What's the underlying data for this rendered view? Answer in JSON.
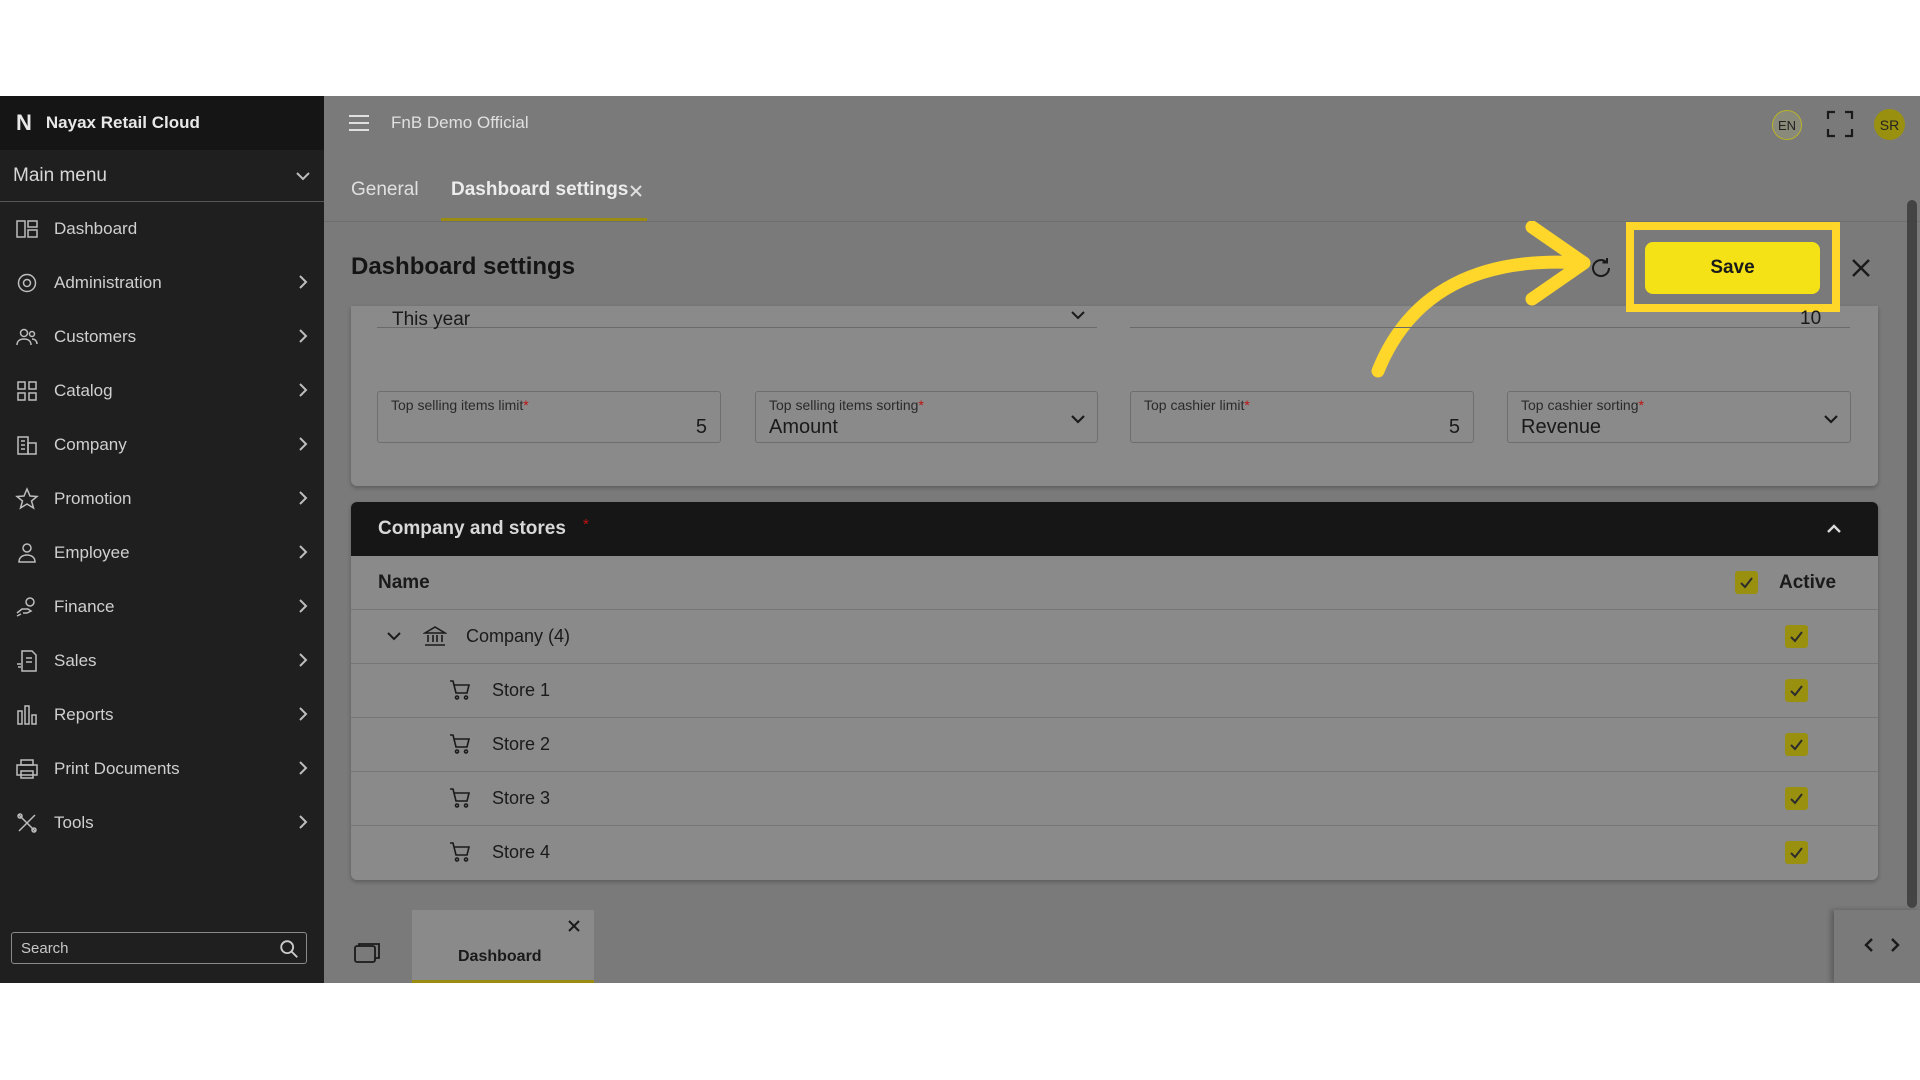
{
  "sidebar": {
    "brand": "Nayax Retail Cloud",
    "main_menu": "Main menu",
    "items": [
      {
        "label": "Dashboard",
        "icon": "dashboard-icon"
      },
      {
        "label": "Administration",
        "icon": "admin-gear-icon"
      },
      {
        "label": "Customers",
        "icon": "customers-icon"
      },
      {
        "label": "Catalog",
        "icon": "catalog-grid-icon"
      },
      {
        "label": "Company",
        "icon": "company-building-icon"
      },
      {
        "label": "Promotion",
        "icon": "star-icon"
      },
      {
        "label": "Employee",
        "icon": "person-icon"
      },
      {
        "label": "Finance",
        "icon": "finance-hand-icon"
      },
      {
        "label": "Sales",
        "icon": "sales-document-icon"
      },
      {
        "label": "Reports",
        "icon": "bar-chart-icon"
      },
      {
        "label": "Print Documents",
        "icon": "printer-icon"
      },
      {
        "label": "Tools",
        "icon": "tools-icon"
      }
    ],
    "search_placeholder": "Search"
  },
  "topbar": {
    "title": "FnB Demo Official",
    "language": "EN",
    "avatar_initials": "SR"
  },
  "tabs": {
    "general": "General",
    "dashboard_settings": "Dashboard settings"
  },
  "panel": {
    "title": "Dashboard settings",
    "save_label": "Save",
    "period_value": "This year",
    "limit_value": "10",
    "fields": {
      "top_selling_limit": {
        "label": "Top selling items limit",
        "value": "5"
      },
      "top_selling_sorting": {
        "label": "Top selling items sorting",
        "value": "Amount"
      },
      "top_cashier_limit": {
        "label": "Top cashier limit",
        "value": "5"
      },
      "top_cashier_sorting": {
        "label": "Top cashier sorting",
        "value": "Revenue"
      }
    },
    "required_mark": "*"
  },
  "company_stores": {
    "title": "Company and stores",
    "col_name": "Name",
    "col_active": "Active",
    "company": "Company (4)",
    "stores": [
      "Store 1",
      "Store 2",
      "Store 3",
      "Store 4"
    ]
  },
  "bottom": {
    "tab_label": "Dashboard"
  },
  "colors": {
    "accent": "#f4e217",
    "highlight": "#ffd62a",
    "sidebar_bg": "#1f1f1f"
  }
}
